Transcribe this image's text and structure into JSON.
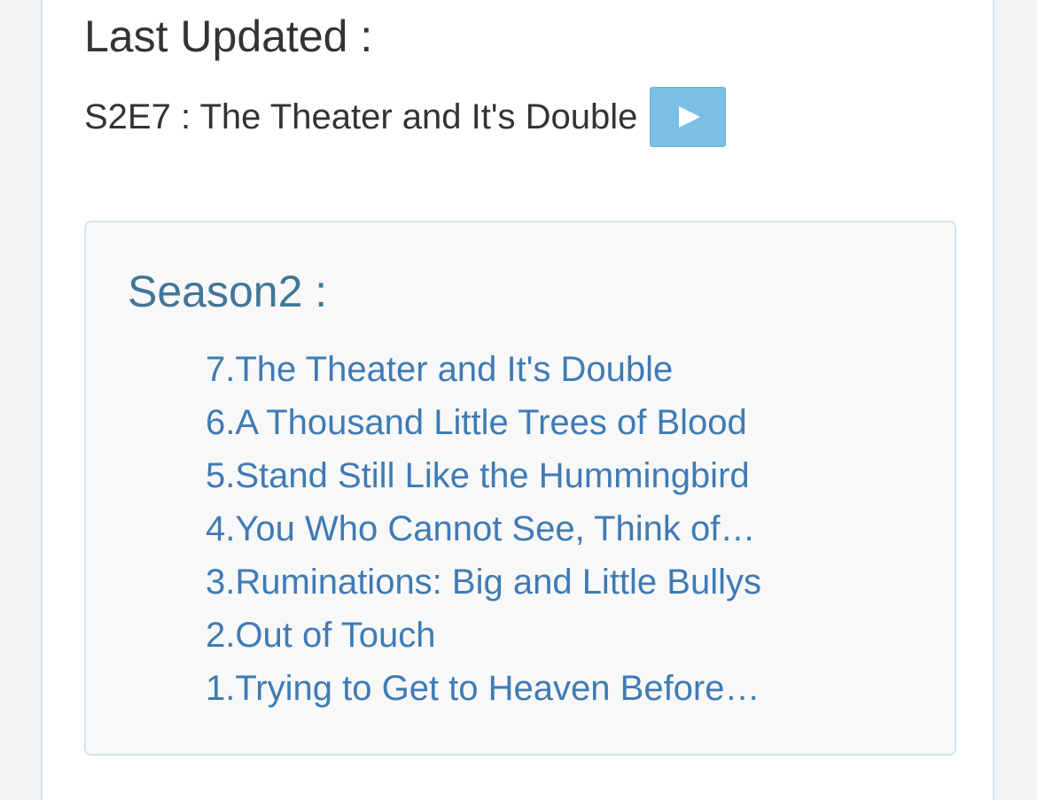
{
  "last_updated": {
    "heading": "Last Updated :",
    "episode": "S2E7 : The Theater and It's Double"
  },
  "season": {
    "title": "Season2 :",
    "episodes": [
      {
        "label": "7.The Theater and It's Double"
      },
      {
        "label": "6.A Thousand Little Trees of Blood"
      },
      {
        "label": "5.Stand Still Like the Hummingbird"
      },
      {
        "label": "4.You Who Cannot See, Think of…"
      },
      {
        "label": "3.Ruminations: Big and Little Bullys"
      },
      {
        "label": "2.Out of Touch"
      },
      {
        "label": "1.Trying to Get to Heaven Before…"
      }
    ]
  },
  "icons": {
    "play": "play-icon"
  },
  "colors": {
    "play_button": "#7abfe4",
    "link": "#3f7bb5",
    "season_title": "#427698",
    "box_border": "#cde6ee"
  }
}
